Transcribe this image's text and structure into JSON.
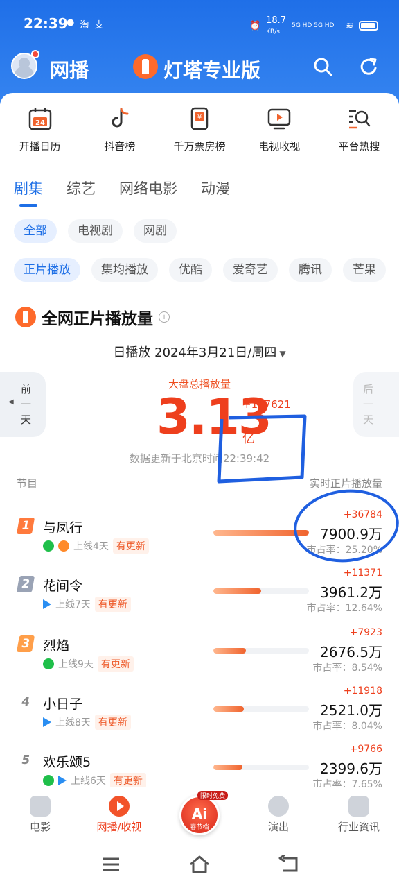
{
  "status": {
    "time": "22:39",
    "apps": [
      "淘",
      "支"
    ],
    "speed": "18.7",
    "speed_unit": "KB/s",
    "net": "5G HD 5G HD"
  },
  "header": {
    "title": "网播",
    "brand": "灯塔专业版"
  },
  "quick_nav": [
    {
      "label": "开播日历",
      "icon": "calendar-icon"
    },
    {
      "label": "抖音榜",
      "icon": "tiktok-icon"
    },
    {
      "label": "千万票房榜",
      "icon": "ticket-icon"
    },
    {
      "label": "电视收视",
      "icon": "tv-icon"
    },
    {
      "label": "平台热搜",
      "icon": "search-list-icon"
    }
  ],
  "calendar_day": "24",
  "ticket_symbol": "¥",
  "tabs": [
    "剧集",
    "综艺",
    "网络电影",
    "动漫"
  ],
  "filters": [
    "全部",
    "电视剧",
    "网剧"
  ],
  "platforms": [
    "正片播放",
    "集均播放",
    "优酷",
    "爱奇艺",
    "腾讯",
    "芒果"
  ],
  "section": {
    "title": "全网正片播放量",
    "info_icon": "i"
  },
  "date": {
    "prefix": "日播放",
    "value": "2024年3月21日/周四",
    "caret": "▼"
  },
  "prev_day": "前一天",
  "next_day": "后一天",
  "total": {
    "label": "大盘总播放量",
    "value": "3.13",
    "unit": "亿",
    "delta": "+117621",
    "updated": "数据更新于北京时间22:39:42"
  },
  "columns": {
    "left": "节目",
    "right": "实时正片播放量"
  },
  "rows": [
    {
      "rank": "1",
      "name": "与凤行",
      "platforms": [
        "iqiyi",
        "youku"
      ],
      "online": "上线4天",
      "badge": "有更新",
      "delta": "+36784",
      "value": "7900.9万",
      "share": "市占率：25.20%",
      "share_pct": 25.2
    },
    {
      "rank": "2",
      "name": "花间令",
      "platforms": [
        "tencent"
      ],
      "online": "上线7天",
      "badge": "有更新",
      "delta": "+11371",
      "value": "3961.2万",
      "share": "市占率：12.64%",
      "share_pct": 12.64
    },
    {
      "rank": "3",
      "name": "烈焰",
      "platforms": [
        "iqiyi"
      ],
      "online": "上线9天",
      "badge": "有更新",
      "delta": "+7923",
      "value": "2676.5万",
      "share": "市占率：8.54%",
      "share_pct": 8.54
    },
    {
      "rank": "4",
      "name": "小日子",
      "platforms": [
        "tencent"
      ],
      "online": "上线8天",
      "badge": "有更新",
      "delta": "+11918",
      "value": "2521.0万",
      "share": "市占率：8.04%",
      "share_pct": 8.04
    },
    {
      "rank": "5",
      "name": "欢乐颂5",
      "platforms": [
        "iqiyi",
        "tencent"
      ],
      "online": "上线6天",
      "badge": "有更新",
      "delta": "+9766",
      "value": "2399.6万",
      "share": "市占率：7.65%",
      "share_pct": 7.65
    }
  ],
  "bottom_nav": [
    {
      "label": "电影",
      "icon": "movie-icon"
    },
    {
      "label": "网播/收视",
      "icon": "play-icon",
      "active": true
    },
    {
      "label": "",
      "icon": "ai-icon"
    },
    {
      "label": "演出",
      "icon": "mic-icon"
    },
    {
      "label": "行业资讯",
      "icon": "news-icon"
    }
  ],
  "ai": {
    "text": "Ai",
    "sub": "春节档",
    "tag": "限时免费"
  },
  "colors": {
    "brand_blue": "#1f6fe8",
    "accent_red": "#ee3f1d",
    "annotation_blue": "#1f5fe0"
  }
}
